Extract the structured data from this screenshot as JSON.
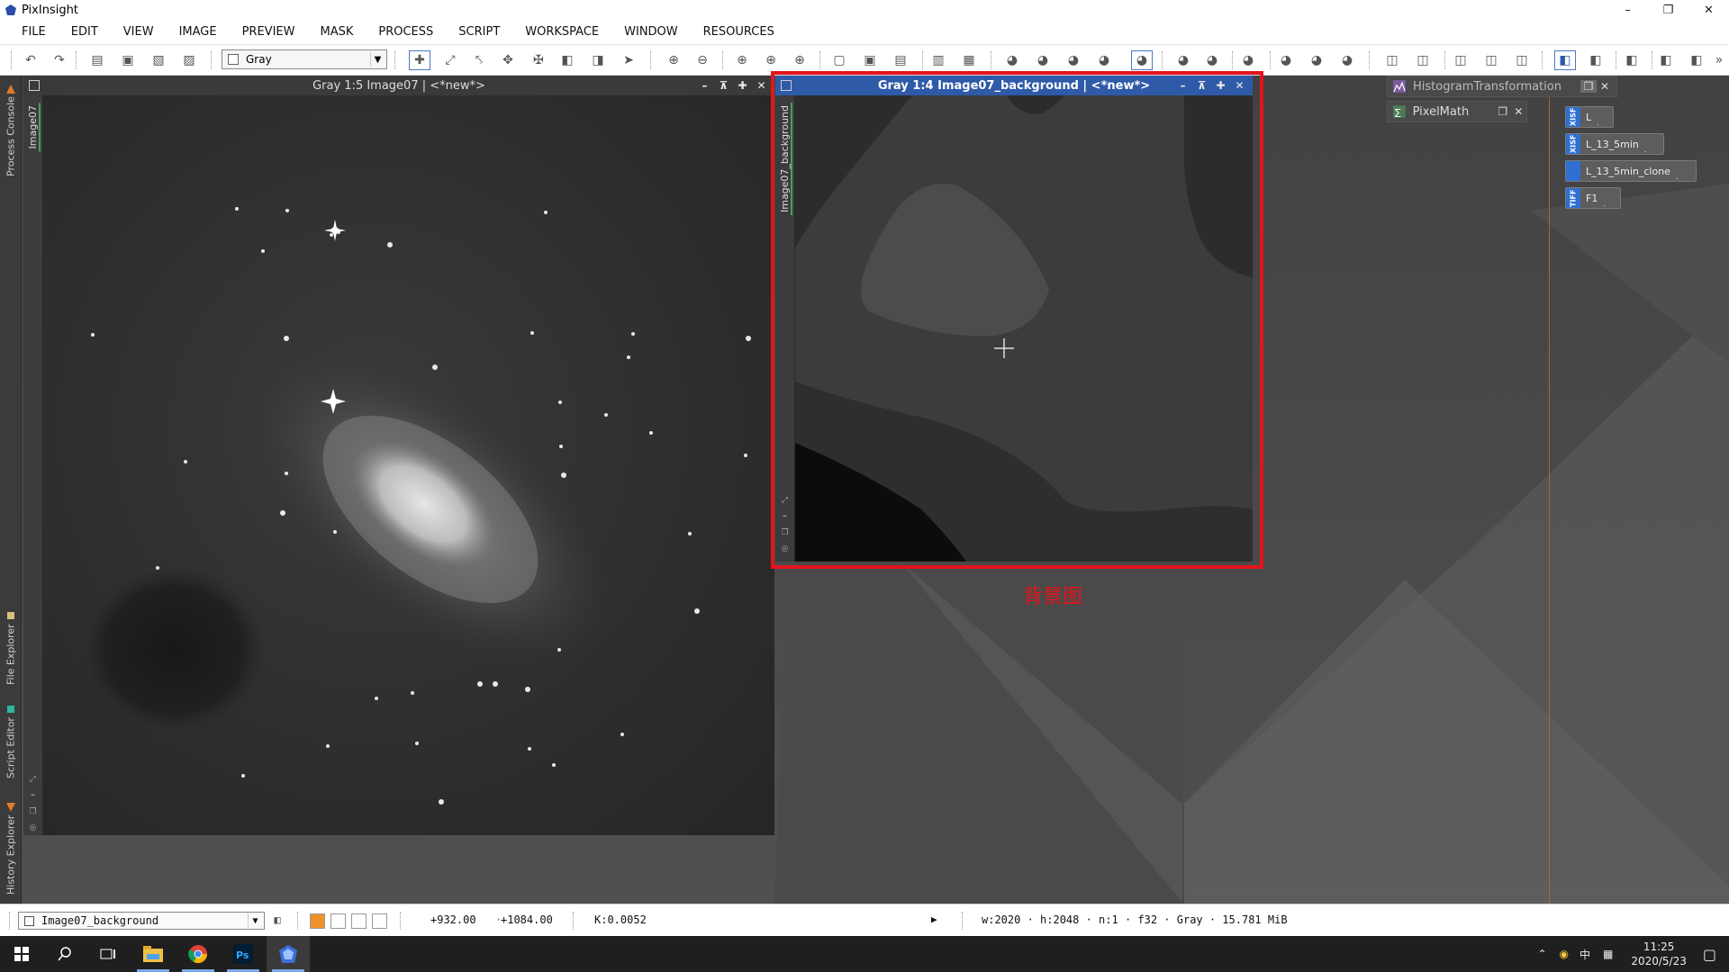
{
  "window": {
    "title": "PixInsight"
  },
  "menu": [
    "FILE",
    "EDIT",
    "VIEW",
    "IMAGE",
    "PREVIEW",
    "MASK",
    "PROCESS",
    "SCRIPT",
    "WORKSPACE",
    "WINDOW",
    "RESOURCES"
  ],
  "toolbar": {
    "colorspace_select": "Gray"
  },
  "left_tabs": {
    "process_console": "Process Console",
    "file_explorer": "File Explorer",
    "script_editor": "Script Editor",
    "history_explorer": "History Explorer"
  },
  "image_windows": {
    "main": {
      "title": "Gray 1:5 Image07 | <*new*>",
      "side_label": "Image07"
    },
    "background": {
      "title": "Gray 1:4 Image07_background | <*new*>",
      "side_label": "Image07_background"
    }
  },
  "annotation": {
    "text": "背景图",
    "color": "#e4141b"
  },
  "process_icons": [
    {
      "label": "HistogramTransformation"
    },
    {
      "label": "PixelMath"
    }
  ],
  "image_icons": [
    {
      "format": "XISF",
      "label": "L"
    },
    {
      "format": "XISF",
      "label": "L_13_5min"
    },
    {
      "format": "",
      "label": "L_13_5min_clone"
    },
    {
      "format": "TIFF",
      "label": "F1"
    }
  ],
  "statusbar": {
    "view": "Image07_background",
    "x": "+932.00",
    "y": "+1084.00",
    "k": "K:0.0052",
    "info": "w:2020 · h:2048 · n:1 · f32 · Gray · 15.781 MiB"
  },
  "taskbar": {
    "time": "11:25",
    "date": "2020/5/23",
    "ime": "中"
  },
  "colors": {
    "accent": "#2f5aa8",
    "highlight": "#e4141b",
    "swatch_active": "#f0922a"
  }
}
